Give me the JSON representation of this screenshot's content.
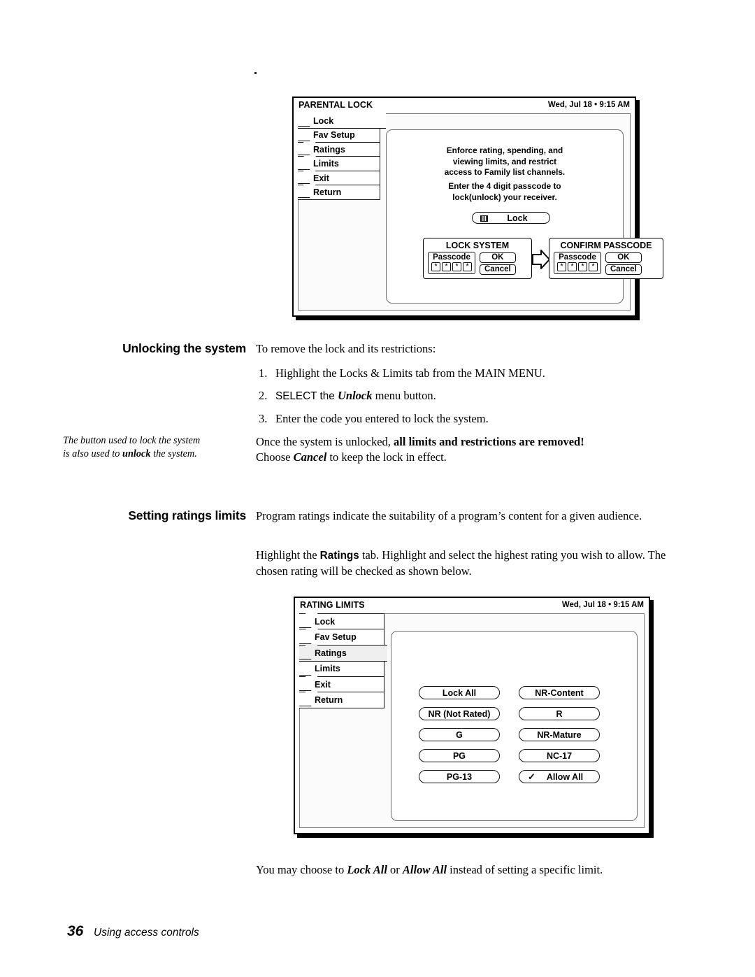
{
  "page": {
    "number": "36",
    "footer_text": "Using access controls"
  },
  "screen1": {
    "title": "PARENTAL LOCK",
    "clock": "Wed, Jul 18 • 9:15 AM",
    "tabs": [
      {
        "label": "Lock",
        "state": "active"
      },
      {
        "label": "Fav Setup",
        "state": "normal"
      },
      {
        "label": "Ratings",
        "state": "normal"
      },
      {
        "label": "Limits",
        "state": "normal"
      },
      {
        "label": "Exit",
        "state": "normal"
      },
      {
        "label": "Return",
        "state": "normal"
      }
    ],
    "description_line1": "Enforce rating, spending, and",
    "description_line2": "viewing limits, and restrict",
    "description_line3": "access to Family list channels.",
    "description_line4": "Enter the 4 digit passcode to",
    "description_line5": "lock(unlock) your receiver.",
    "lock_button": "Lock",
    "dialog_lock": {
      "title": "LOCK SYSTEM",
      "passcode_label": "Passcode",
      "passcode_chars": [
        "*",
        "*",
        "*",
        "*"
      ],
      "ok_label": "OK",
      "cancel_label": "Cancel"
    },
    "dialog_confirm": {
      "title": "CONFIRM PASSCODE",
      "passcode_label": "Passcode",
      "passcode_chars": [
        "*",
        "*",
        "*",
        "*"
      ],
      "ok_label": "OK",
      "cancel_label": "Cancel"
    }
  },
  "section_unlock": {
    "heading": "Unlocking the system",
    "intro": "To remove the lock and its restrictions:",
    "steps": [
      {
        "num": "1.",
        "text_pre": "Highlight the ",
        "bold1": "Locks & Limits",
        "text_mid": " tab from the ",
        "bold2": "MAIN MENU",
        "text_post": "."
      },
      {
        "num": "2.",
        "text_pre": "SELECT the ",
        "italic1": "Unlock",
        "text_post": " menu button."
      },
      {
        "num": "3.",
        "text_pre": "Enter the code you entered to lock the system."
      }
    ],
    "outro_pre": "Once the system is unlocked, ",
    "outro_bold": "all limits and restrictions are removed!",
    "outro_line2_pre": "Choose ",
    "outro_line2_italic": "Cancel",
    "outro_line2_post": " to keep the lock in effect.",
    "margin_note_line1": "The button used to lock the system",
    "margin_note_line2_pre": "is also used to ",
    "margin_note_line2_bold": "unlock",
    "margin_note_line2_post": " the system."
  },
  "section_ratings": {
    "heading": "Setting ratings limits",
    "para1": "Program ratings indicate the suitability of a program’s content for a given audience.",
    "para2_pre": "Highlight the ",
    "para2_bold": "Ratings",
    "para2_post": " tab. Highlight and select the highest rating you wish to allow. The chosen rating will be checked as shown below."
  },
  "screen2": {
    "title": "RATING LIMITS",
    "clock": "Wed, Jul 18 • 9:15 AM",
    "tabs": [
      {
        "label": "Lock",
        "state": "normal"
      },
      {
        "label": "Fav Setup",
        "state": "normal"
      },
      {
        "label": "Ratings",
        "state": "active"
      },
      {
        "label": "Limits",
        "state": "normal"
      },
      {
        "label": "Exit",
        "state": "normal"
      },
      {
        "label": "Return",
        "state": "normal"
      }
    ],
    "ratings_left": [
      {
        "label": "Lock All",
        "checked": false
      },
      {
        "label": "NR (Not Rated)",
        "checked": false
      },
      {
        "label": "G",
        "checked": false
      },
      {
        "label": "PG",
        "checked": false
      },
      {
        "label": "PG-13",
        "checked": false
      }
    ],
    "ratings_right": [
      {
        "label": "NR-Content",
        "checked": false
      },
      {
        "label": "R",
        "checked": false
      },
      {
        "label": "NR-Mature",
        "checked": false
      },
      {
        "label": "NC-17",
        "checked": false
      },
      {
        "label": "Allow All",
        "checked": true,
        "check_glyph": "✓"
      }
    ]
  },
  "closing_note": {
    "pre": "You may choose to ",
    "italic1": "Lock All",
    "mid": " or ",
    "italic2": "Allow All",
    "post": " instead of setting a specific limit."
  }
}
